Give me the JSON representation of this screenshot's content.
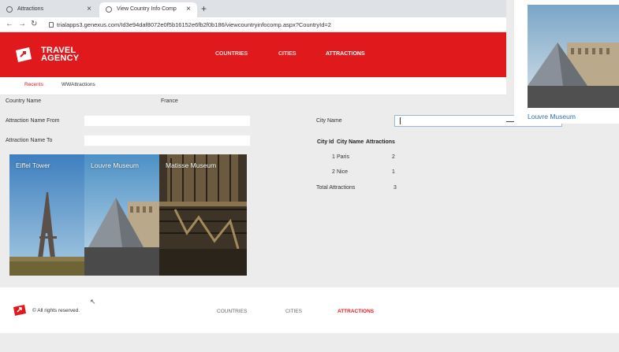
{
  "browser": {
    "tabs": [
      {
        "title": "Attractions",
        "active": false
      },
      {
        "title": "View Country Info Comp",
        "active": true
      }
    ],
    "url": "trialapps3.genexus.com/Id3e94daf8072e0f5b16152e6fb2f0b186/viewcountryinfocomp.aspx?CountryId=2"
  },
  "header": {
    "logo_line1": "TRAVEL",
    "logo_line2": "AGENCY",
    "nav": [
      "COUNTRIES",
      "CITIES",
      "ATTRACTIONS"
    ],
    "active_nav": "ATTRACTIONS"
  },
  "subtabs": {
    "recents": "Recents",
    "wwattractions": "WWAttractions"
  },
  "form": {
    "country_name_label": "Country Name",
    "country_name_value": "France",
    "attraction_from_label": "Attraction Name From",
    "attraction_to_label": "Attraction Name To",
    "city_name_label": "City Name",
    "city_name_value": ""
  },
  "gallery": [
    {
      "caption": "Eiffel Tower"
    },
    {
      "caption": "Louvre Museum"
    },
    {
      "caption": "Matisse Museum"
    }
  ],
  "grid": {
    "headers": [
      "City Id",
      "City Name",
      "Attractions"
    ],
    "rows": [
      {
        "id": "1",
        "name": "Paris",
        "attractions": "2"
      },
      {
        "id": "2",
        "name": "Nice",
        "attractions": "1"
      }
    ],
    "total_label": "Total Attractions",
    "total_value": "3"
  },
  "popup": {
    "caption": "Louvre Museum"
  },
  "footer": {
    "copyright": "© All rights reserved.",
    "nav": [
      "COUNTRIES",
      "CITIES",
      "ATTRACTIONS"
    ]
  },
  "colors": {
    "brand_red": "#e0191c",
    "link_blue": "#2a6fb5"
  }
}
